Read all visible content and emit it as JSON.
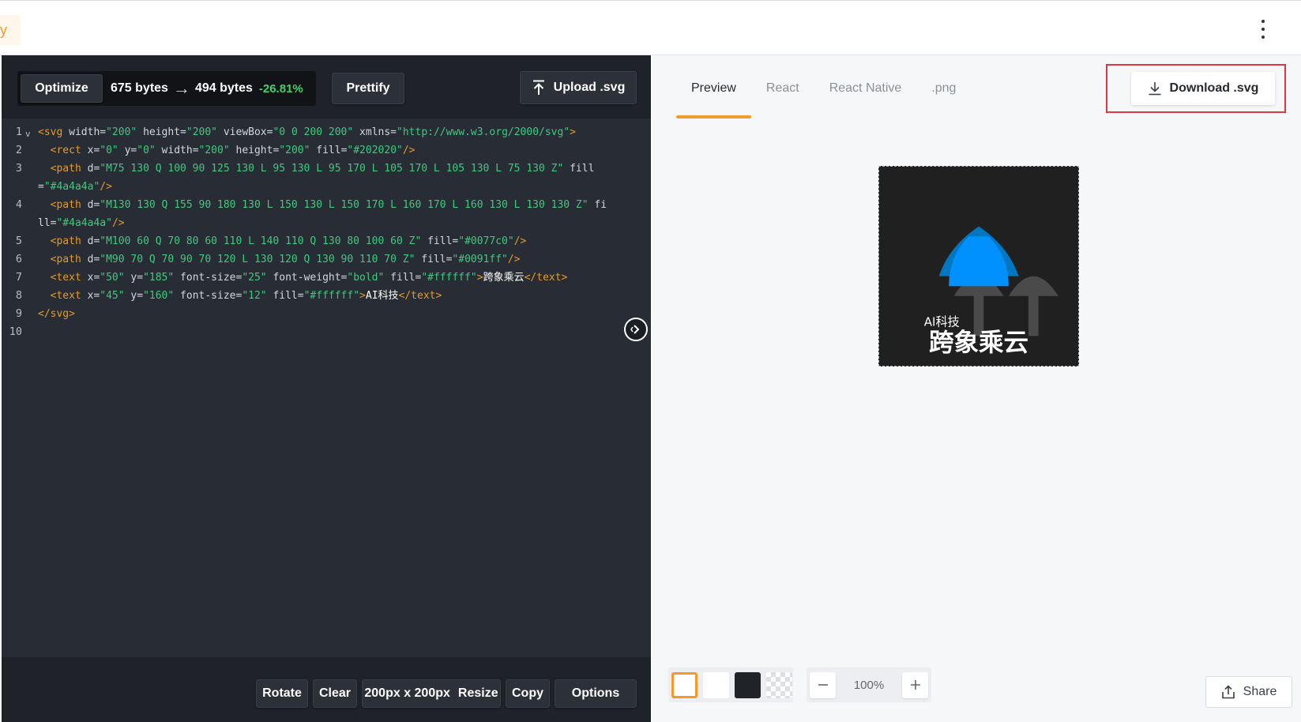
{
  "header": {
    "logo_fragment": "y",
    "menu_icon": "more-vertical-icon"
  },
  "toolbar": {
    "optimize_label": "Optimize",
    "original_size": "675 bytes",
    "optimized_size": "494 bytes",
    "percent_change": "-26.81%",
    "prettify_label": "Prettify",
    "upload_label": "Upload .svg",
    "upload_icon": "upload-icon"
  },
  "code": {
    "line_numbers": [
      "1",
      "2",
      "3",
      "4",
      "5",
      "6",
      "7",
      "8",
      "9",
      "10"
    ]
  },
  "footer": {
    "rotate_label": "Rotate",
    "clear_label": "Clear",
    "size_label": "200px x 200px",
    "resize_label": "Resize",
    "copy_label": "Copy",
    "options_label": "Options"
  },
  "preview": {
    "tabs": [
      {
        "label": "Preview",
        "active": true
      },
      {
        "label": "React",
        "active": false
      },
      {
        "label": "React Native",
        "active": false
      },
      {
        "label": ".png",
        "active": false
      }
    ],
    "download_label": "Download .svg",
    "download_icon": "download-icon",
    "rendered_svg": {
      "background": "#202020",
      "cap_color": "#0077c0",
      "cap_highlight_color": "#0091ff",
      "stem_color": "#4a4a4a",
      "subtitle": "AI科技",
      "title": "跨象乘云"
    },
    "zoom_value": "100%",
    "share_label": "Share",
    "share_icon": "share-icon"
  },
  "colors": {
    "accent": "#f39a2b",
    "code_tag": "#e49a2d",
    "code_value": "#3fc97e",
    "positive_change": "#3fd06a",
    "highlight_frame": "#e0363f"
  }
}
